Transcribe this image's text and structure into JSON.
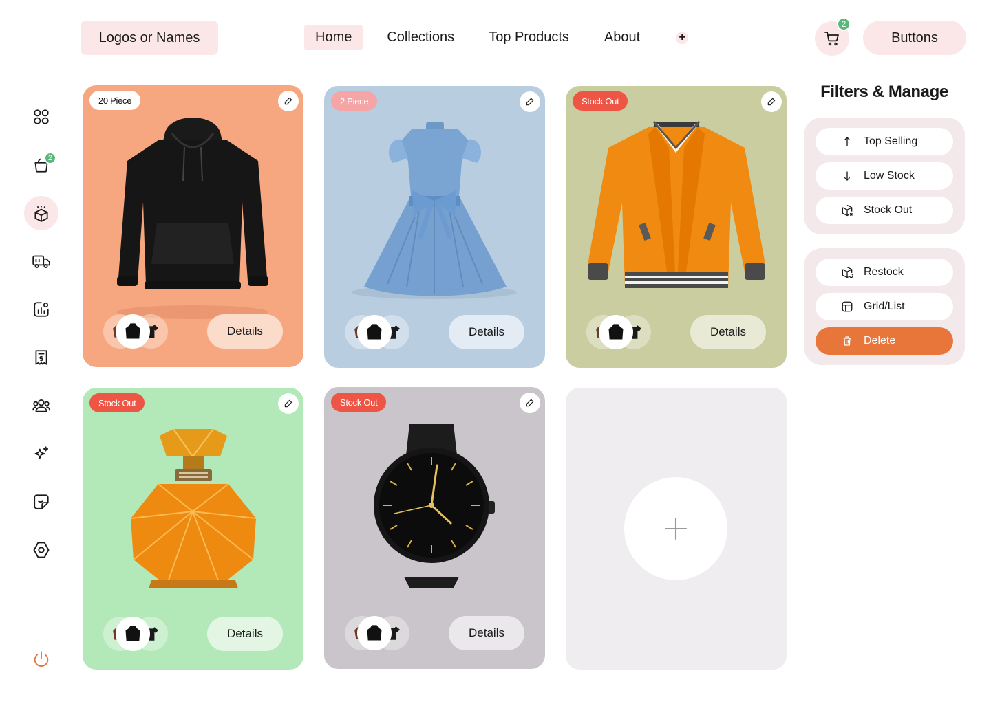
{
  "header": {
    "logo_label": "Logos or Names",
    "nav": [
      {
        "label": "Home",
        "active": true
      },
      {
        "label": "Collections",
        "active": false
      },
      {
        "label": "Top Products",
        "active": false
      },
      {
        "label": "About",
        "active": false
      }
    ],
    "nav_add_symbol": "+",
    "cart_count": "2",
    "button_label": "Buttons"
  },
  "sidebar": {
    "items": [
      {
        "icon": "grid-icon",
        "active": false
      },
      {
        "icon": "shopping-bag-icon",
        "active": false,
        "badge": "2"
      },
      {
        "icon": "box-icon",
        "active": true
      },
      {
        "icon": "truck-icon",
        "active": false
      },
      {
        "icon": "analytics-icon",
        "active": false
      },
      {
        "icon": "invoice-icon",
        "active": false
      },
      {
        "icon": "users-icon",
        "active": false
      },
      {
        "icon": "sparkle-icon",
        "active": false
      },
      {
        "icon": "sticker-icon",
        "active": false
      },
      {
        "icon": "settings-icon",
        "active": false
      }
    ],
    "power_icon": "power-icon"
  },
  "cards": [
    {
      "tag": "20 Piece",
      "tag_style": "white",
      "product": "black-hoodie",
      "bg": "#f6a77f",
      "details_bg": "#fbdccb",
      "details_label": "Details"
    },
    {
      "tag": "2 Piece",
      "tag_style": "pink",
      "product": "blue-dress",
      "bg": "#b8cde0",
      "details_bg": "#e3ecf5",
      "details_label": "Details"
    },
    {
      "tag": "Stock Out",
      "tag_style": "red",
      "product": "orange-jacket",
      "bg": "#c9cd9f",
      "details_bg": "#e9ead6",
      "details_label": "Details"
    },
    {
      "tag": "Stock Out",
      "tag_style": "red",
      "product": "perfume-bottle",
      "bg": "#b3e8b8",
      "details_bg": "#e2f6e3",
      "details_label": "Details"
    },
    {
      "tag": "Stock Out",
      "tag_style": "red",
      "product": "wrist-watch",
      "bg": "#cac5ca",
      "details_bg": "#ebe8eb",
      "details_label": "Details"
    }
  ],
  "add_card": {
    "symbol": "+"
  },
  "panel": {
    "title": "Filters & Manage",
    "filters": [
      {
        "label": "Top Selling",
        "icon": "arrow-up-icon"
      },
      {
        "label": "Low Stock",
        "icon": "arrow-down-icon"
      },
      {
        "label": "Stock Out",
        "icon": "box-x-icon"
      }
    ],
    "actions": [
      {
        "label": "Restock",
        "icon": "box-refresh-icon"
      },
      {
        "label": "Grid/List",
        "icon": "layout-icon"
      },
      {
        "label": "Delete",
        "icon": "trash-icon",
        "danger": true
      }
    ]
  },
  "colors": {
    "accent": "#e8753a",
    "soft_pink": "#fbe6e8",
    "badge_green": "#5cb87a",
    "stock_out_red": "#ee5544"
  }
}
